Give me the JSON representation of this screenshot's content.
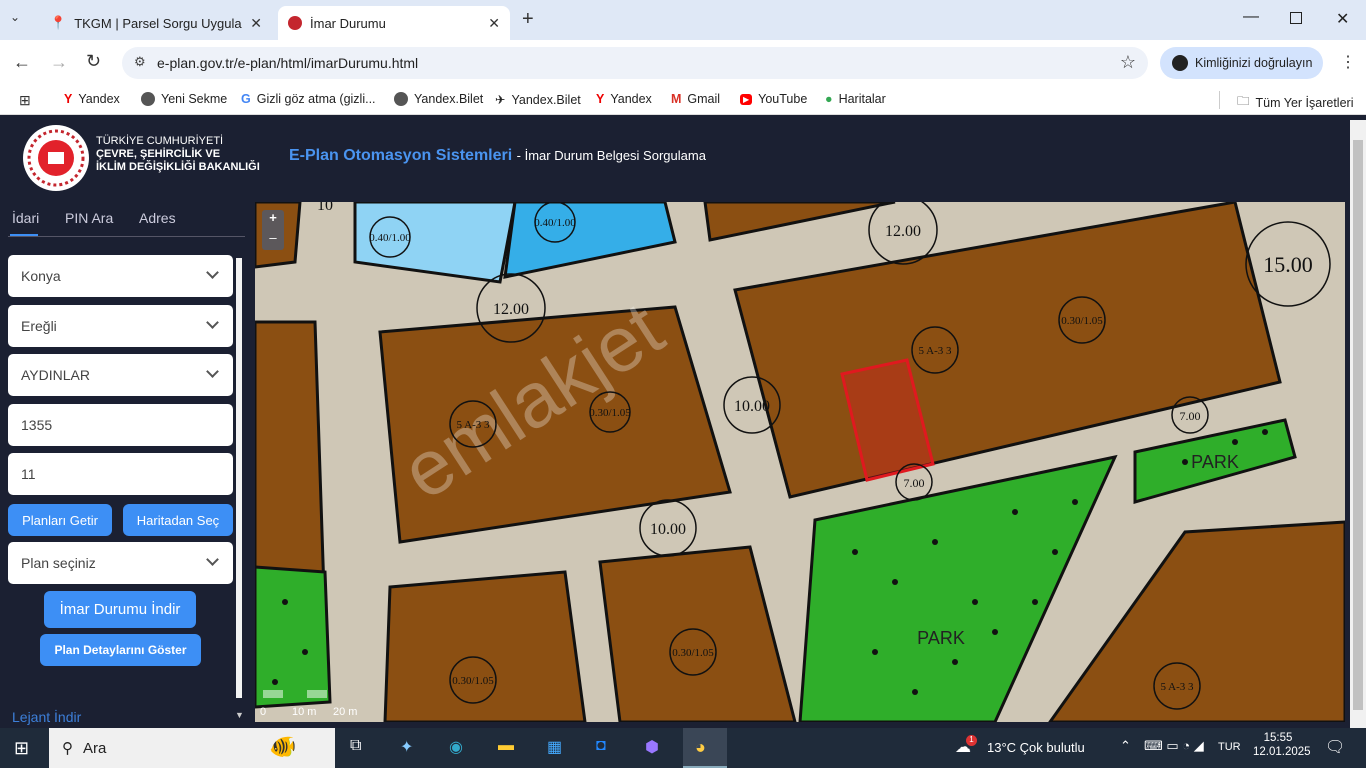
{
  "browser": {
    "tabs": [
      {
        "title": "TKGM | Parsel Sorgu Uygulaması",
        "active": false
      },
      {
        "title": "İmar Durumu",
        "active": true
      }
    ],
    "url": "e-plan.gov.tr/e-plan/html/imarDurumu.html",
    "profile_label": "Kimliğinizi doğrulayın",
    "bookmarks": [
      "Yandex",
      "Yeni Sekme",
      "Gizli göz atma (gizli...",
      "Yandex.Bilet",
      "Yandex.Bilet",
      "Yandex",
      "Gmail",
      "YouTube",
      "Haritalar"
    ],
    "all_bookmarks": "Tüm Yer İşaretleri"
  },
  "header": {
    "ministry_line1": "TÜRKİYE CUMHURİYETİ",
    "ministry_line2": "ÇEVRE, ŞEHİRCİLİK VE",
    "ministry_line3": "İKLİM DEĞİŞİKLİĞİ BAKANLIĞI",
    "system_title": "E-Plan Otomasyon Sistemleri",
    "subtitle": "- İmar Durum Belgesi Sorgulama",
    "accent": "#3d8ff5"
  },
  "sidebar": {
    "tabs": [
      "İdari",
      "PIN Ara",
      "Adres"
    ],
    "province": "Konya",
    "district": "Ereğli",
    "neighborhood": "AYDINLAR",
    "block": "1355",
    "parcel": "11",
    "get_plans": "Planları Getir",
    "select_from_map": "Haritadan Seç",
    "plan_select": "Plan seçiniz",
    "download_zoning": "İmar Durumu İndir",
    "show_plan_details": "Plan Detaylarını Göster",
    "legend_download": "Lejant İndir"
  },
  "map": {
    "zoom_in": "+",
    "zoom_out": "–",
    "watermark": "emlakjet",
    "road_labels": [
      "12.00",
      "12.00",
      "10.00",
      "10.00",
      "7.00",
      "7.00",
      "15.00",
      "10"
    ],
    "density_labels": [
      "0.30/1.05",
      "0.30/1.05",
      "0.30/1.05",
      "0.30/1.05",
      "0.40/1.00",
      "0.40/1.00"
    ],
    "zone_labels": [
      "5 A-3 3",
      "5 A-3 3",
      "5 A-3 3"
    ],
    "park_labels": [
      "PARK",
      "PARK"
    ],
    "scale": [
      "0",
      "10 m",
      "20 m"
    ],
    "colors": {
      "residential": "#8b4f12",
      "park": "#2fae2a",
      "blue": "#35aee8",
      "selected": "#e0191f"
    }
  },
  "taskbar": {
    "search": "Ara",
    "weather": "13°C  Çok bulutlu",
    "lang": "TUR",
    "time": "15:55",
    "date": "12.01.2025",
    "notif_badge": "1"
  }
}
